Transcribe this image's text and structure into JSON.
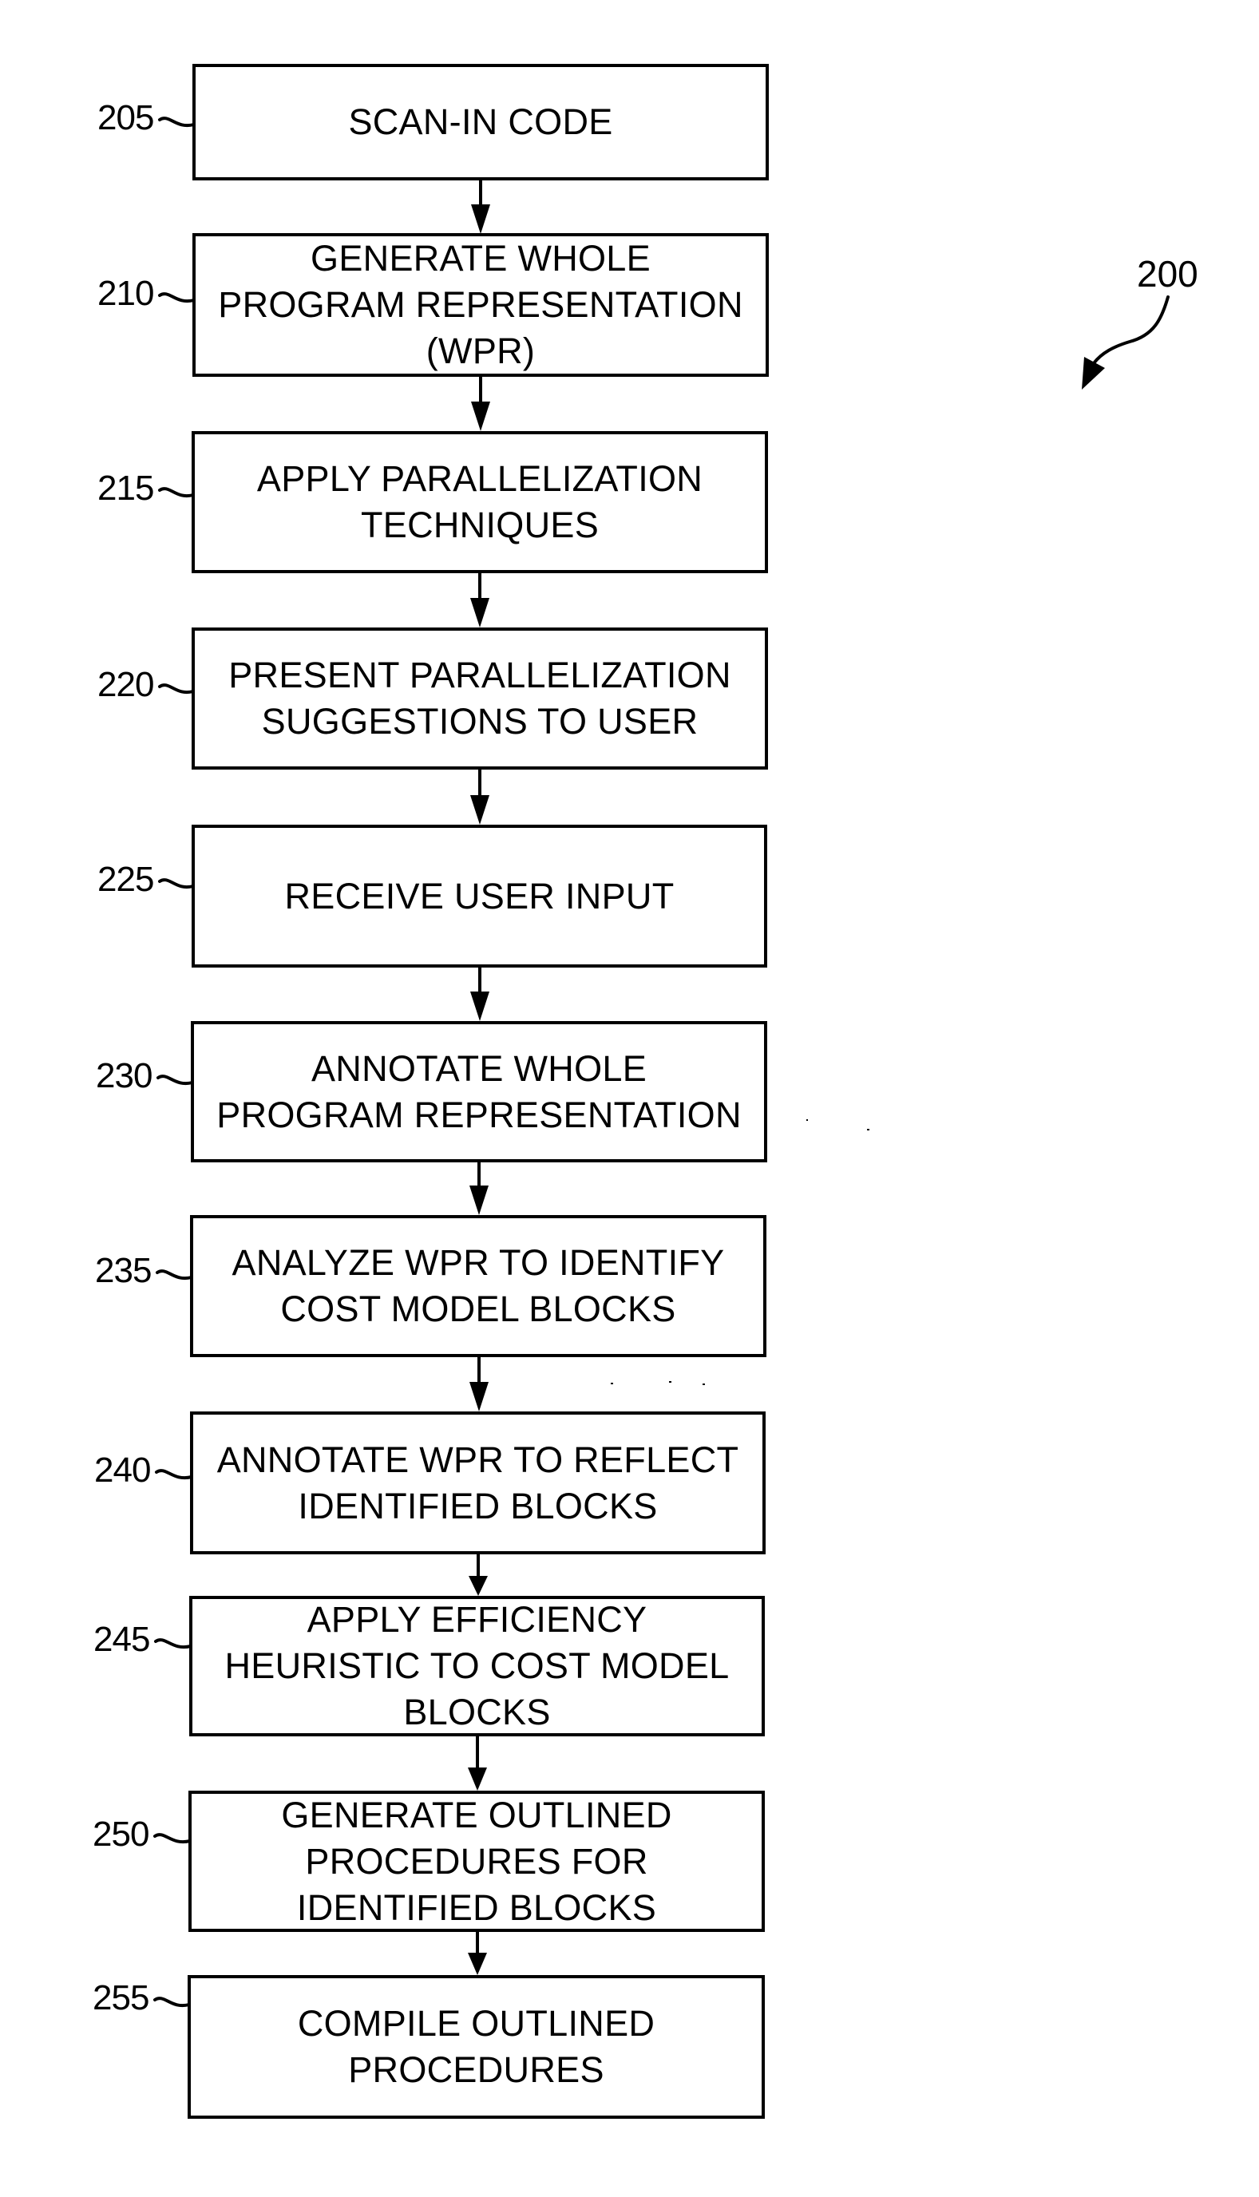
{
  "figure": {
    "reference": "200",
    "steps": [
      {
        "ref": "205",
        "lines": [
          "SCAN-IN CODE"
        ]
      },
      {
        "ref": "210",
        "lines": [
          "GENERATE WHOLE",
          "PROGRAM REPRESENTATION",
          "(WPR)"
        ]
      },
      {
        "ref": "215",
        "lines": [
          "APPLY PARALLELIZATION",
          "TECHNIQUES"
        ]
      },
      {
        "ref": "220",
        "lines": [
          "PRESENT PARALLELIZATION",
          "SUGGESTIONS TO USER"
        ]
      },
      {
        "ref": "225",
        "lines": [
          "RECEIVE USER INPUT"
        ]
      },
      {
        "ref": "230",
        "lines": [
          "ANNOTATE WHOLE",
          "PROGRAM REPRESENTATION"
        ]
      },
      {
        "ref": "235",
        "lines": [
          "ANALYZE WPR TO IDENTIFY",
          "COST MODEL BLOCKS"
        ]
      },
      {
        "ref": "240",
        "lines": [
          "ANNOTATE WPR TO REFLECT",
          "IDENTIFIED BLOCKS"
        ]
      },
      {
        "ref": "245",
        "lines": [
          "APPLY EFFICIENCY",
          "HEURISTIC TO COST MODEL",
          "BLOCKS"
        ]
      },
      {
        "ref": "250",
        "lines": [
          "GENERATE OUTLINED",
          "PROCEDURES FOR",
          "IDENTIFIED BLOCKS"
        ]
      },
      {
        "ref": "255",
        "lines": [
          "COMPILE OUTLINED",
          "PROCEDURES"
        ]
      }
    ]
  }
}
